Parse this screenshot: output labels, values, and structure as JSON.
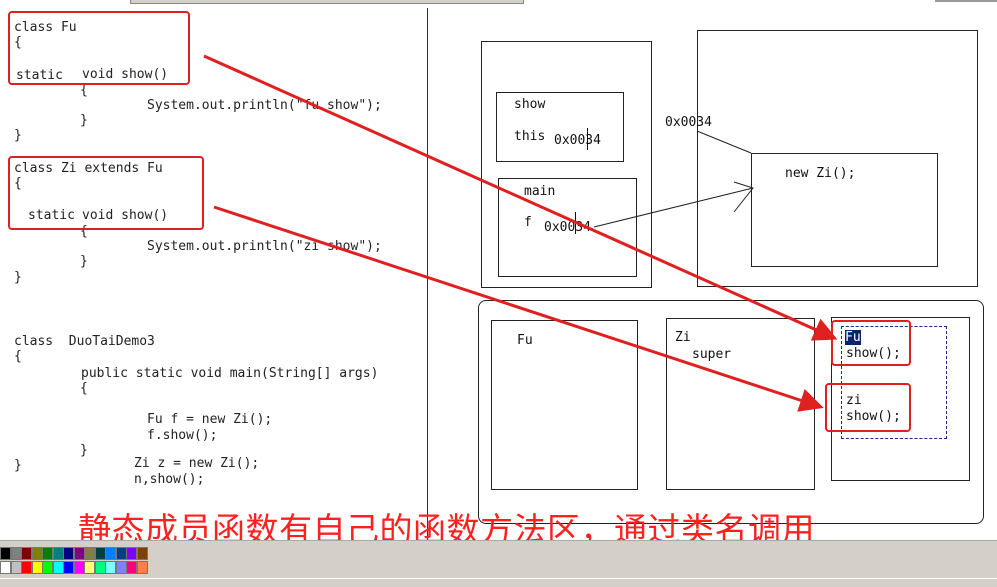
{
  "code": {
    "fu_class": "class Fu",
    "fu_open": "{",
    "fu_static": "static",
    "fu_void_show": "void show()",
    "fu_m_open": "{",
    "fu_println": "System.out.println(\"fu show\");",
    "fu_m_close": "}",
    "fu_close": "}",
    "zi_class": "class Zi extends Fu",
    "zi_open": "{",
    "zi_static": "static",
    "zi_void_show": "void show()",
    "zi_m_open": "{",
    "zi_println": "System.out.println(\"zi show\");",
    "zi_m_close": "}",
    "zi_close": "}",
    "demo_class": "class  DuoTaiDemo3",
    "demo_open": "{",
    "main_sig": "public static void main(String[] args)",
    "main_open": "{",
    "line_fu_f": "Fu f = new Zi();",
    "line_f_show": "f.show();",
    "main_close": "}",
    "demo_close": "}",
    "line_zi_z": "Zi z = new Zi();",
    "line_n_show": "n,show();"
  },
  "stack": {
    "show_label": "show",
    "this_label": "this",
    "this_addr": "0x0034",
    "main_label": "main",
    "f_label": "f",
    "f_addr": "0x0034"
  },
  "heap": {
    "addr": "0x0034",
    "new_zi": "new Zi();"
  },
  "method_area": {
    "fu_label": "Fu",
    "zi_label": "Zi",
    "super_label": "super",
    "static_fu": "Fu",
    "static_fu_show": "show();",
    "static_zi": "zi",
    "static_zi_show": "show();"
  },
  "caption": "静态成员函数有自己的函数方法区，通过类名调用",
  "colors": {
    "annotation_red": "#e02020",
    "caption_red": "#ff2020",
    "selection_blue": "#0a246a",
    "palette": [
      "#000000",
      "#808080",
      "#800000",
      "#808000",
      "#008000",
      "#008080",
      "#000080",
      "#800080",
      "#808040",
      "#004040",
      "#0080ff",
      "#004080",
      "#8000ff",
      "#804000",
      "#ffffff",
      "#c0c0c0",
      "#ff0000",
      "#ffff00",
      "#00ff00",
      "#00ffff",
      "#0000ff",
      "#ff00ff",
      "#ffff80",
      "#00ff80",
      "#80ffff",
      "#8080ff",
      "#ff0080",
      "#ff8040"
    ]
  }
}
